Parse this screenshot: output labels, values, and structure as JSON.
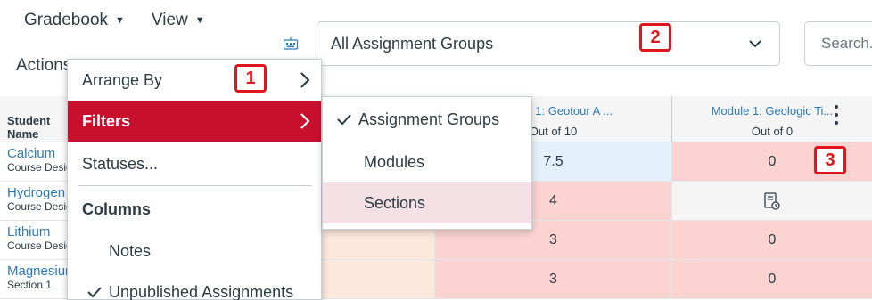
{
  "nav": {
    "gradebook_label": "Gradebook",
    "view_label": "View",
    "actions_label": "Actions"
  },
  "filters_bar": {
    "group_select_value": "All Assignment Groups",
    "search_placeholder": "Search..."
  },
  "callouts": [
    "1",
    "2",
    "3"
  ],
  "grid": {
    "student_header": "Student Name",
    "columns": [
      {
        "title": "Module 1: Geotour A ...",
        "subtitle": "Out of 10"
      },
      {
        "title": "Module 1: Geologic Ti...",
        "subtitle": "Out of 0"
      }
    ],
    "rows": [
      {
        "name": "Calcium",
        "section": "Course Designer",
        "score_a": "7.5",
        "score_b": "0"
      },
      {
        "name": "Hydrogen",
        "section": "Course Designer",
        "score_a": "4",
        "score_b": ""
      },
      {
        "name": "Lithium",
        "section": "Course Designer",
        "score_a": "3",
        "score_b": "0"
      },
      {
        "name": "Magnesium",
        "section": "Section 1",
        "score_a": "3",
        "score_b": "0"
      }
    ]
  },
  "view_menu": {
    "arrange_by": "Arrange By",
    "filters": "Filters",
    "statuses": "Statuses...",
    "columns_heading": "Columns",
    "notes": "Notes",
    "unpublished": "Unpublished Assignments"
  },
  "filters_submenu": {
    "items": [
      {
        "label": "Assignment Groups",
        "checked": true
      },
      {
        "label": "Modules",
        "checked": false
      },
      {
        "label": "Sections",
        "checked": false
      }
    ]
  },
  "colors": {
    "accent_red": "#c8102e",
    "callout_red": "#e0161f",
    "link_blue": "#2b7abc",
    "late_pink": "#fbd3d0",
    "edited_blue": "#e3f1fb",
    "late_peach": "#fde8dc"
  }
}
